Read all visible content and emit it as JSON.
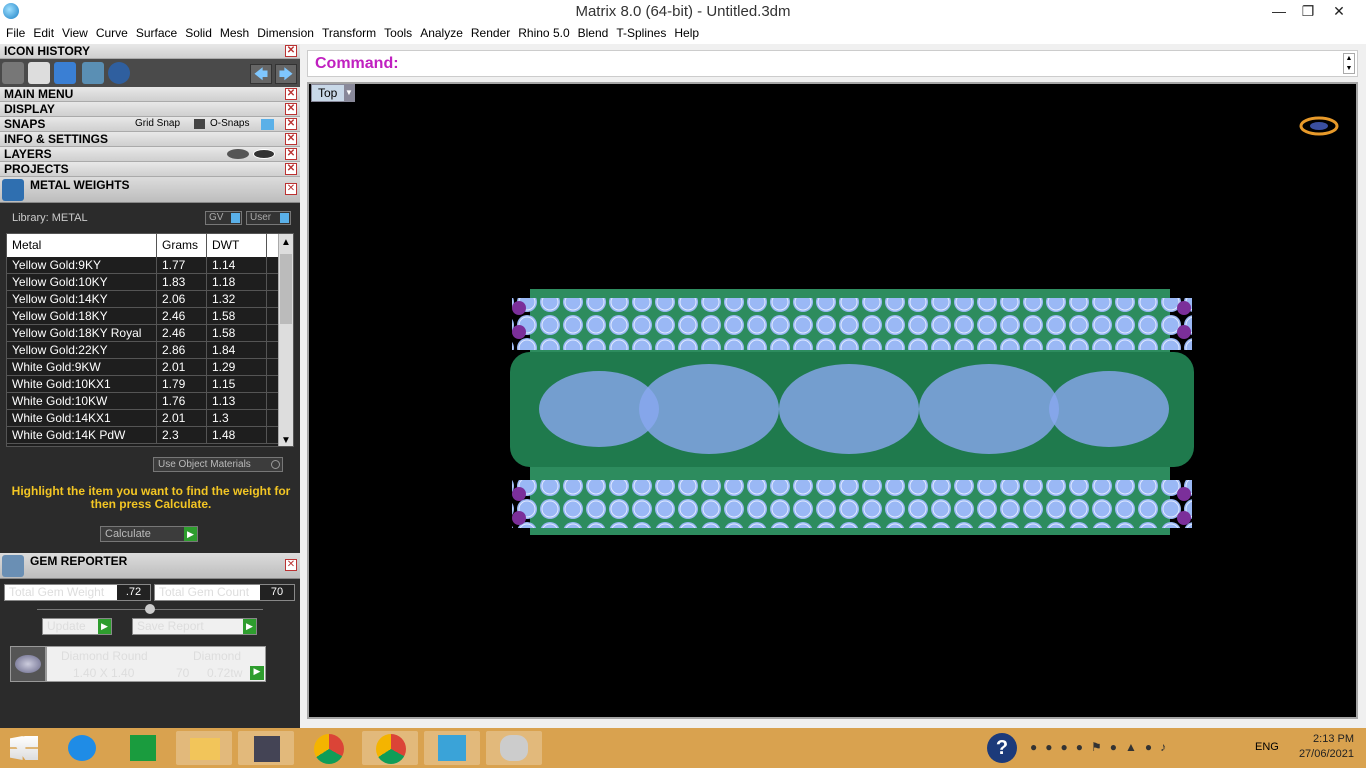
{
  "window": {
    "title": "Matrix 8.0 (64-bit) - Untitled.3dm"
  },
  "menu": [
    "File",
    "Edit",
    "View",
    "Curve",
    "Surface",
    "Solid",
    "Mesh",
    "Dimension",
    "Transform",
    "Tools",
    "Analyze",
    "Render",
    "Rhino 5.0",
    "Blend",
    "T-Splines",
    "Help"
  ],
  "panels": {
    "icon_history": "ICON HISTORY",
    "main_menu": "MAIN MENU",
    "display": "DISPLAY",
    "snaps": "SNAPS",
    "grid_snap": "Grid Snap",
    "o_snaps": "O-Snaps",
    "info": "INFO & SETTINGS",
    "layers": "LAYERS",
    "projects": "PROJECTS"
  },
  "metal_weights": {
    "title": "METAL WEIGHTS",
    "library": "Library: METAL",
    "gv": "GV",
    "user": "User",
    "columns": [
      "Metal",
      "Grams",
      "DWT"
    ],
    "rows": [
      [
        "Yellow Gold:9KY",
        "1.77",
        "1.14"
      ],
      [
        "Yellow Gold:10KY",
        "1.83",
        "1.18"
      ],
      [
        "Yellow Gold:14KY",
        "2.06",
        "1.32"
      ],
      [
        "Yellow Gold:18KY",
        "2.46",
        "1.58"
      ],
      [
        "Yellow Gold:18KY Royal",
        "2.46",
        "1.58"
      ],
      [
        "Yellow Gold:22KY",
        "2.86",
        "1.84"
      ],
      [
        "White Gold:9KW",
        "2.01",
        "1.29"
      ],
      [
        "White Gold:10KX1",
        "1.79",
        "1.15"
      ],
      [
        "White Gold:10KW",
        "1.76",
        "1.13"
      ],
      [
        "White Gold:14KX1",
        "2.01",
        "1.3"
      ],
      [
        "White Gold:14K PdW",
        "2.3",
        "1.48"
      ]
    ],
    "use_object_materials": "Use Object Materials",
    "hint": "Highlight the item you want to find the weight for then press Calculate.",
    "calculate": "Calculate"
  },
  "gem_reporter": {
    "title": "GEM REPORTER",
    "total_weight_label": "Total Gem Weight",
    "total_weight": ".72",
    "total_count_label": "Total Gem Count",
    "total_count": "70",
    "update": "Update",
    "save_report": "Save Report",
    "gem_shape": "Diamond Round",
    "gem_size": "1.40 X 1.40",
    "gem_material": "Diamond",
    "gem_count": "70",
    "gem_tw": "0.72tw"
  },
  "command": {
    "label": "Command:"
  },
  "viewport": {
    "label": "Top"
  },
  "taskbar": {
    "lang": "ENG",
    "time": "2:13 PM",
    "date": "27/06/2021"
  }
}
